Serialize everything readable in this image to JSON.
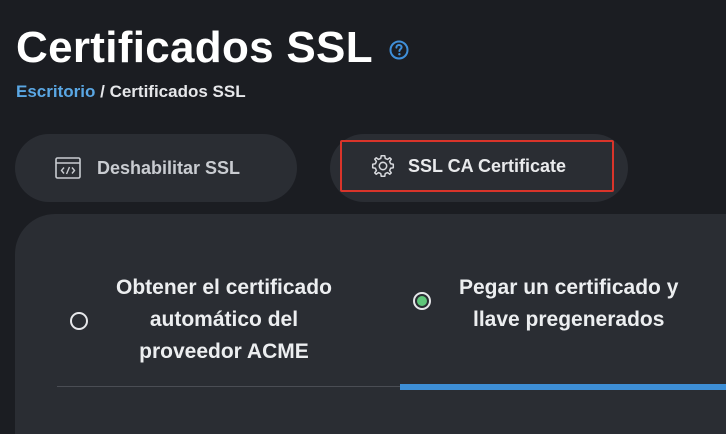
{
  "header": {
    "title": "Certificados SSL",
    "help_icon": "help-circle-icon"
  },
  "breadcrumb": {
    "link": "Escritorio",
    "separator": "/",
    "current": "Certificados SSL"
  },
  "actions": {
    "disable_ssl_label": "Deshabilitar SSL",
    "disable_ssl_icon": "code-window-icon",
    "ssl_ca_label": "SSL CA Certificate",
    "ssl_ca_icon": "gear-icon"
  },
  "options": {
    "acme": {
      "line1": "Obtener el certificado",
      "line2": "automático del",
      "line3": "proveedor ACME",
      "selected": false
    },
    "paste": {
      "line1": "Pegar un certificado y",
      "line2": "llave pregenerados",
      "selected": true
    }
  },
  "colors": {
    "background": "#1b1d22",
    "surface": "#2a2d33",
    "link": "#5aa7e4",
    "highlight_border": "#d9342a",
    "radio_selected": "#5fc67a",
    "active_tab": "#3d8ed6"
  }
}
